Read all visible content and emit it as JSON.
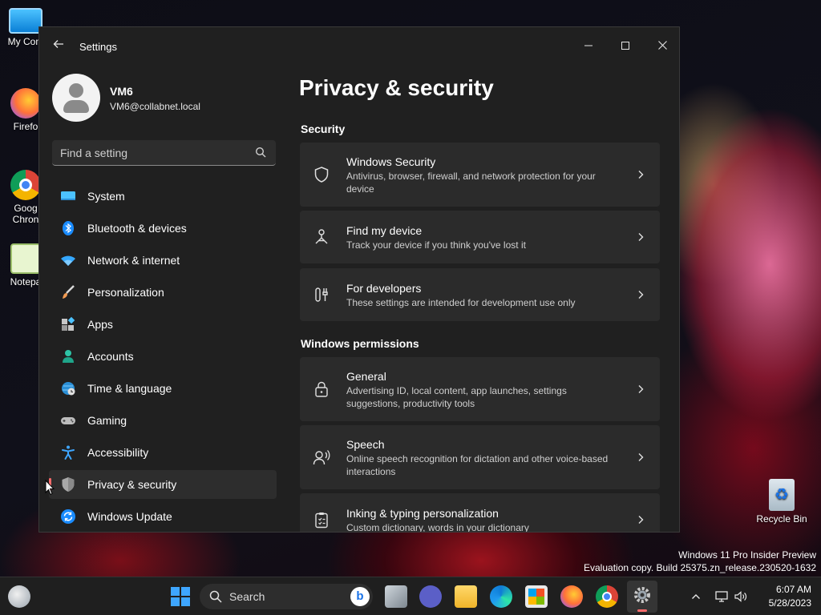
{
  "desktop": {
    "icons": [
      {
        "label": "My Com",
        "icon": "computer-icon"
      },
      {
        "label": "Firefo",
        "icon": "firefox-icon"
      },
      {
        "label": "Goog",
        "label2": "Chron",
        "icon": "chrome-icon"
      },
      {
        "label": "Notepa",
        "icon": "notepad-icon"
      }
    ],
    "recycle_bin": "Recycle Bin",
    "watermark_line1": "Windows 11 Pro Insider Preview",
    "watermark_line2": "Evaluation copy. Build 25375.zn_release.230520-1632"
  },
  "window": {
    "title": "Settings",
    "back_icon": "back-arrow-icon",
    "controls": {
      "minimize": "–",
      "maximize": "□",
      "close": "✕"
    }
  },
  "profile": {
    "name": "VM6",
    "email": "VM6@collabnet.local"
  },
  "search": {
    "placeholder": "Find a setting"
  },
  "nav": [
    {
      "label": "System",
      "icon": "monitor-icon"
    },
    {
      "label": "Bluetooth & devices",
      "icon": "bluetooth-icon"
    },
    {
      "label": "Network & internet",
      "icon": "wifi-icon"
    },
    {
      "label": "Personalization",
      "icon": "brush-icon"
    },
    {
      "label": "Apps",
      "icon": "apps-icon"
    },
    {
      "label": "Accounts",
      "icon": "person-icon"
    },
    {
      "label": "Time & language",
      "icon": "globe-clock-icon"
    },
    {
      "label": "Gaming",
      "icon": "gamepad-icon"
    },
    {
      "label": "Accessibility",
      "icon": "accessibility-icon"
    },
    {
      "label": "Privacy & security",
      "icon": "shield-icon",
      "selected": true
    },
    {
      "label": "Windows Update",
      "icon": "update-icon"
    }
  ],
  "content": {
    "title": "Privacy & security",
    "sections": [
      {
        "heading": "Security",
        "cards": [
          {
            "title": "Windows Security",
            "desc": "Antivirus, browser, firewall, and network protection for your device",
            "icon": "shield-outline-icon"
          },
          {
            "title": "Find my device",
            "desc": "Track your device if you think you've lost it",
            "icon": "person-location-icon"
          },
          {
            "title": "For developers",
            "desc": "These settings are intended for development use only",
            "icon": "developer-tools-icon"
          }
        ]
      },
      {
        "heading": "Windows permissions",
        "cards": [
          {
            "title": "General",
            "desc": "Advertising ID, local content, app launches, settings suggestions, productivity tools",
            "icon": "lock-icon"
          },
          {
            "title": "Speech",
            "desc": "Online speech recognition for dictation and other voice-based interactions",
            "icon": "speech-icon"
          },
          {
            "title": "Inking & typing personalization",
            "desc": "Custom dictionary, words in your dictionary",
            "icon": "clipboard-icon"
          }
        ]
      }
    ]
  },
  "taskbar": {
    "search_label": "Search",
    "time": "6:07 AM",
    "date": "5/28/2023"
  },
  "colors": {
    "window_bg": "#202020",
    "card_bg": "#2b2b2b",
    "selection_accent": "#ff6b6b",
    "taskbar_bg": "#1f1f1f"
  }
}
